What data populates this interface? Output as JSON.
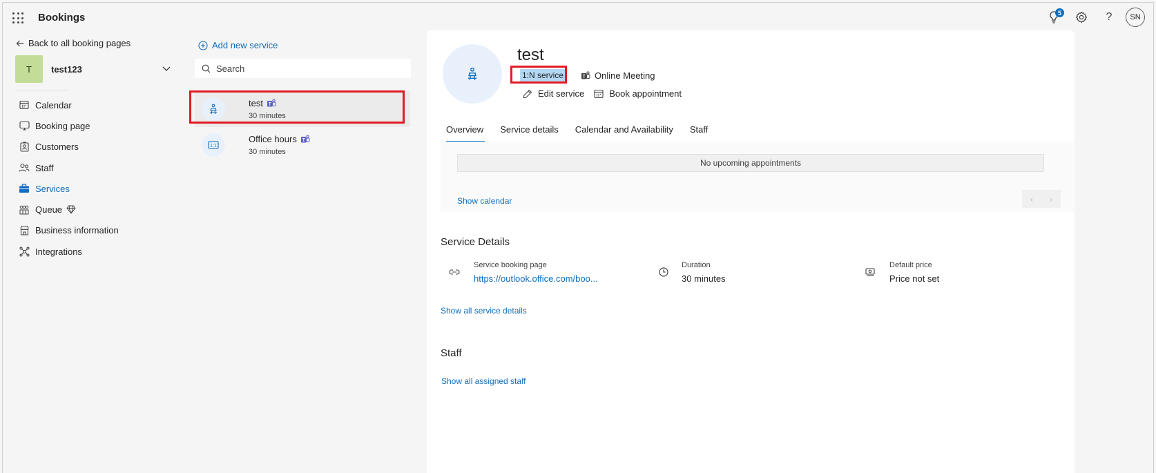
{
  "app": {
    "title": "Bookings"
  },
  "topbar": {
    "notification_count": "5",
    "avatar_initials": "SN"
  },
  "leftnav": {
    "back_label": "Back to all booking pages",
    "account": {
      "initial": "T",
      "name": "test123"
    },
    "items": [
      {
        "label": "Calendar",
        "icon": "calendar-icon"
      },
      {
        "label": "Booking page",
        "icon": "monitor-icon"
      },
      {
        "label": "Customers",
        "icon": "contact-card-icon"
      },
      {
        "label": "Staff",
        "icon": "people-icon"
      },
      {
        "label": "Services",
        "icon": "briefcase-icon",
        "active": true
      },
      {
        "label": "Queue",
        "icon": "queue-icon",
        "premium": true
      },
      {
        "label": "Business information",
        "icon": "building-icon"
      },
      {
        "label": "Integrations",
        "icon": "network-icon"
      }
    ]
  },
  "services": {
    "add_label": "Add new service",
    "search_placeholder": "Search",
    "items": [
      {
        "name": "test",
        "duration": "30 minutes",
        "selected": true
      },
      {
        "name": "Office hours",
        "duration": "30 minutes",
        "selected": false
      }
    ]
  },
  "detail": {
    "title": "test",
    "type_tag": "1:N service",
    "meeting_type": "Online Meeting",
    "edit_label": "Edit service",
    "book_label": "Book appointment",
    "tabs": [
      "Overview",
      "Service details",
      "Calendar and Availability",
      "Staff"
    ],
    "no_appointments": "No upcoming appointments",
    "show_calendar": "Show calendar",
    "service_details_heading": "Service Details",
    "booking_page_label": "Service booking page",
    "booking_page_url": "https://outlook.office.com/boo...",
    "duration_label": "Duration",
    "duration_value": "30 minutes",
    "price_label": "Default price",
    "price_value": "Price not set",
    "show_all_details": "Show all service details",
    "staff_heading": "Staff",
    "show_all_staff": "Show all assigned staff"
  },
  "colors": {
    "accent": "#0f6cbd",
    "highlight_box": "#e01b24",
    "tag_bg": "#b3d7f2",
    "account_avatar": "#c3dd98"
  }
}
